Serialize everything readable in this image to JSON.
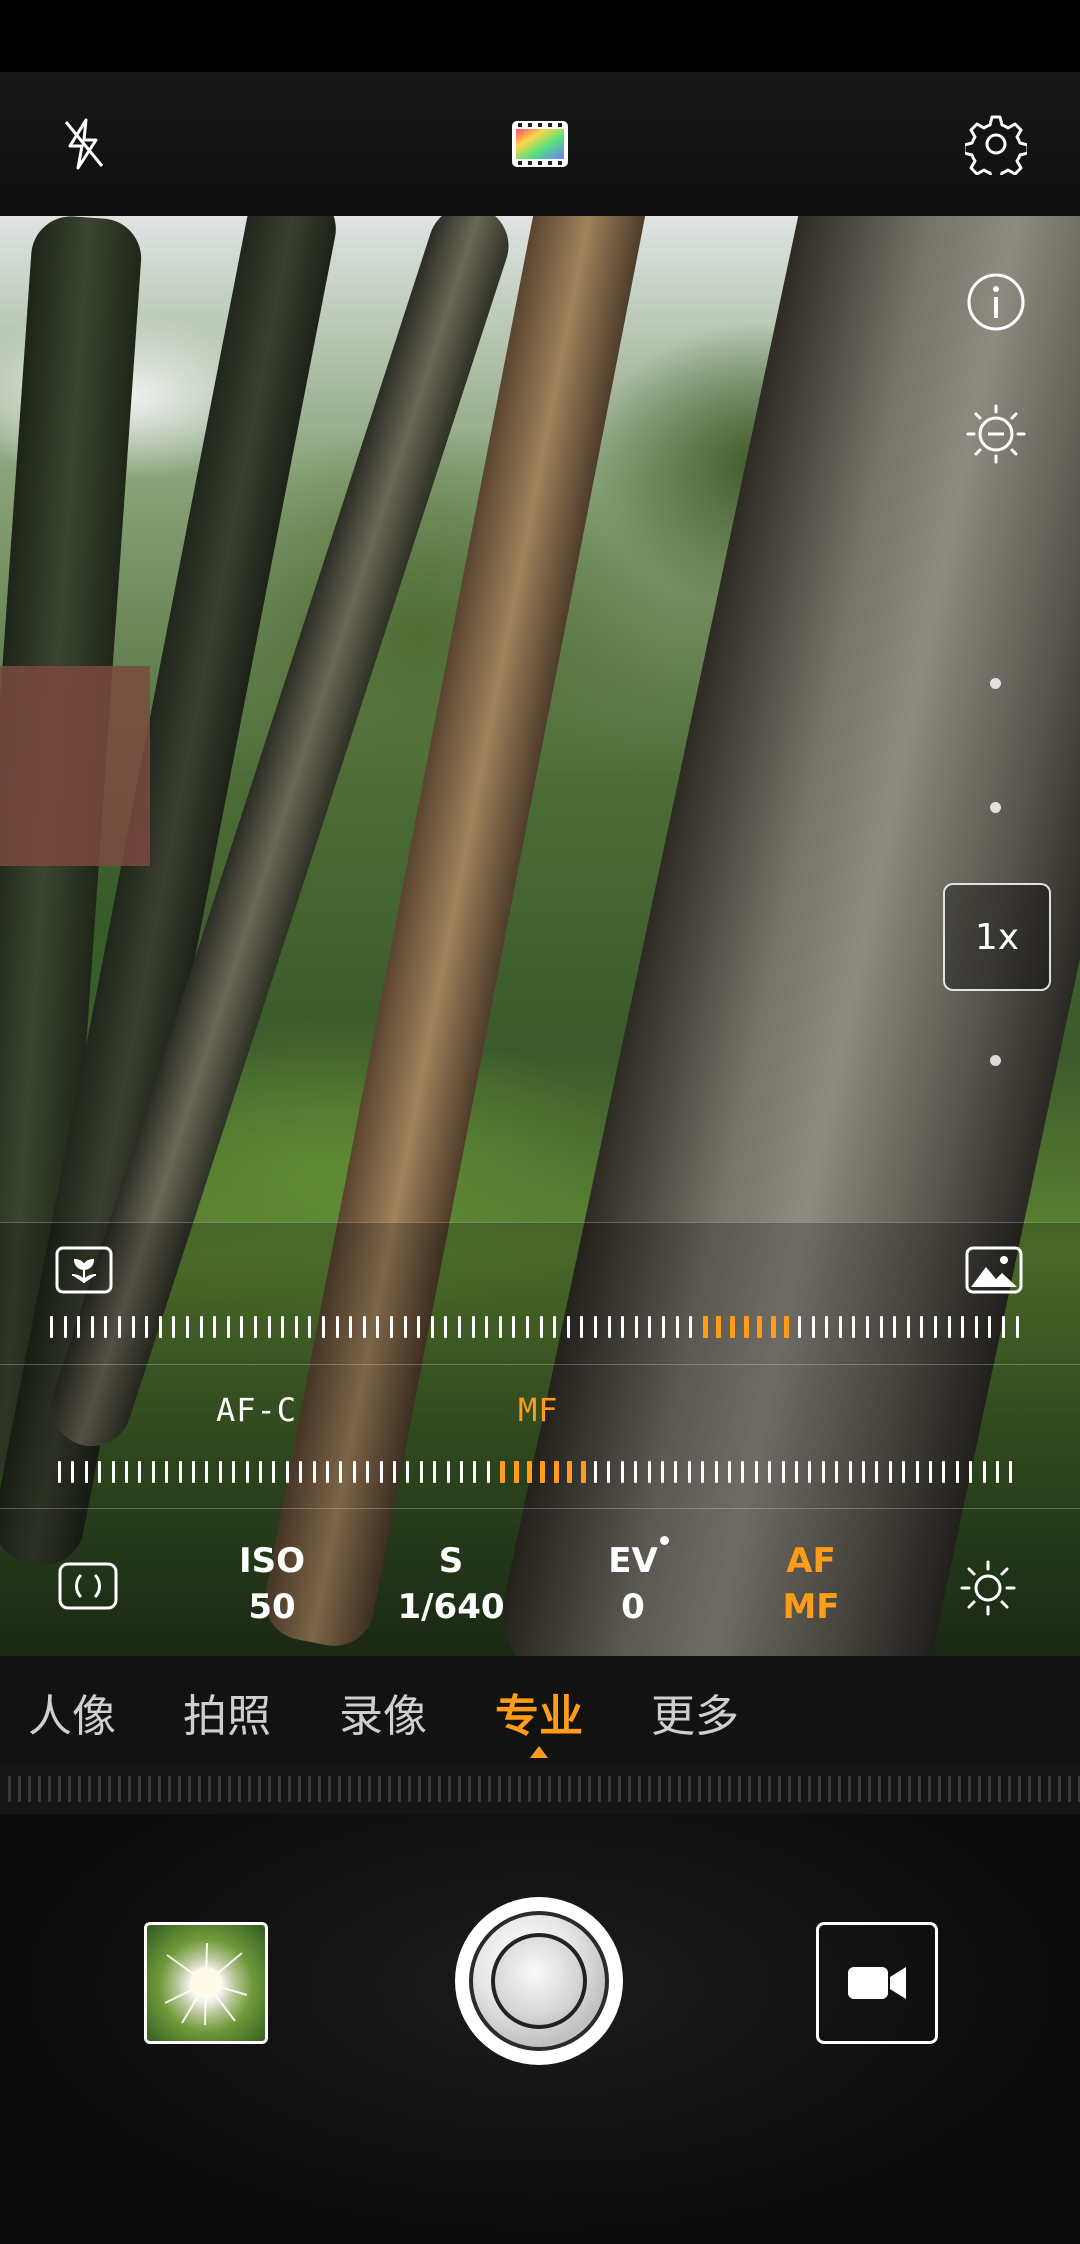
{
  "top_bar": {
    "flash_icon": "flash-off-icon",
    "filter_icon": "color-filter-icon",
    "settings_icon": "gear-icon"
  },
  "side_controls": {
    "info_icon": "info-icon",
    "exposure_icon": "exposure-minus-icon",
    "zoom_label": "1x"
  },
  "focus_ruler": {
    "left_icon": "macro-flower-icon",
    "right_icon": "landscape-icon",
    "labels": {
      "afc": "AF-C",
      "mf": "MF"
    }
  },
  "params": {
    "metering_icon": "metering-icon",
    "iso": {
      "name": "ISO",
      "value": "50"
    },
    "shutter": {
      "name": "S",
      "value": "1/640"
    },
    "ev": {
      "name": "EV",
      "value": "0"
    },
    "focus": {
      "name": "AF",
      "value": "MF"
    },
    "wb_icon": "white-balance-icon"
  },
  "modes": {
    "items": [
      "人像",
      "拍照",
      "录像",
      "专业",
      "更多"
    ],
    "active": "专业"
  },
  "bottom_bar": {
    "gallery_icon": "gallery-thumbnail",
    "shutter_icon": "shutter-button",
    "video_icon": "video-camera-icon"
  },
  "colors": {
    "accent": "#ff9d1a",
    "text": "#ffffff"
  }
}
